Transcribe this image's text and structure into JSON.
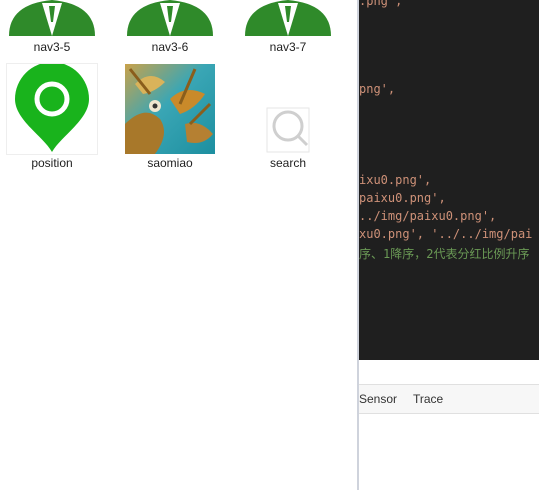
{
  "files": [
    {
      "name": "nav3-5",
      "icon": "user-avatar-icon"
    },
    {
      "name": "nav3-6",
      "icon": "user-avatar-icon"
    },
    {
      "name": "nav3-7",
      "icon": "user-avatar-icon"
    },
    {
      "name": "position",
      "icon": "location-pin-icon"
    },
    {
      "name": "saomiao",
      "icon": "photo-thumbnail"
    },
    {
      "name": "search",
      "icon": "magnifier-icon"
    }
  ],
  "editor": {
    "lines": [
      ".png',",
      "png',",
      "ixu0.png',",
      "paixu0.png',",
      "../img/paixu0.png',",
      "xu0.png', '../../img/pai",
      "序、1降序，2代表分红比例升序"
    ]
  },
  "bottom_tabs": [
    "Sensor",
    "Trace"
  ],
  "colors": {
    "avatar_green": "#2f8a2a",
    "pin_green": "#19b31c",
    "editor_bg": "#1f1f1f",
    "string": "#ce9178",
    "comment": "#6a9955"
  }
}
